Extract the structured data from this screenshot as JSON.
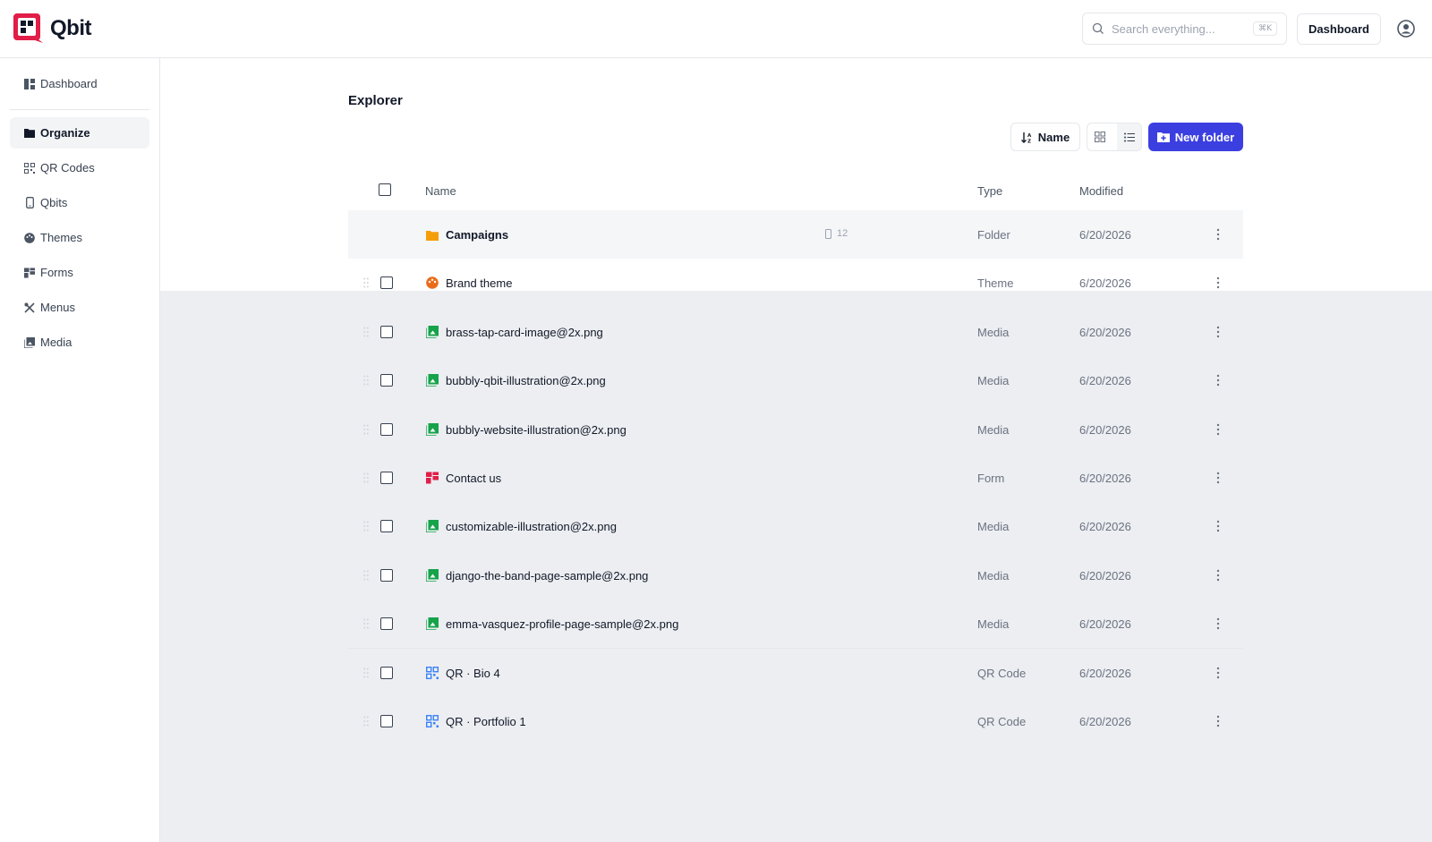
{
  "app": {
    "name": "Qbit"
  },
  "header": {
    "search_placeholder": "Search everything...",
    "search_shortcut": "⌘K",
    "dashboard_button": "Dashboard"
  },
  "sidebar": {
    "items": [
      {
        "label": "Dashboard",
        "icon": "dashboard-icon",
        "active": false
      },
      {
        "label": "Organize",
        "icon": "folder-icon",
        "active": true
      },
      {
        "label": "QR Codes",
        "icon": "qr-code-icon",
        "active": false
      },
      {
        "label": "Qbits",
        "icon": "phone-icon",
        "active": false
      },
      {
        "label": "Themes",
        "icon": "palette-icon",
        "active": false
      },
      {
        "label": "Forms",
        "icon": "form-icon",
        "active": false
      },
      {
        "label": "Menus",
        "icon": "utensils-icon",
        "active": false
      },
      {
        "label": "Media",
        "icon": "media-icon",
        "active": false
      }
    ]
  },
  "main": {
    "title": "Explorer",
    "sort_label": "Name",
    "new_folder_label": "New folder",
    "columns": {
      "name": "Name",
      "type": "Type",
      "modified": "Modified"
    },
    "rows": [
      {
        "name": "Campaigns",
        "type": "Folder",
        "modified": "6/20/2026",
        "icon": "folder-icon",
        "count": "12"
      },
      {
        "name": "Brand theme",
        "type": "Theme",
        "modified": "6/20/2026",
        "icon": "palette-icon"
      },
      {
        "name": "brass-tap-card-image@2x.png",
        "type": "Media",
        "modified": "6/20/2026",
        "icon": "image-icon"
      },
      {
        "name": "bubbly-qbit-illustration@2x.png",
        "type": "Media",
        "modified": "6/20/2026",
        "icon": "image-icon"
      },
      {
        "name": "bubbly-website-illustration@2x.png",
        "type": "Media",
        "modified": "6/20/2026",
        "icon": "image-icon"
      },
      {
        "name": "Contact us",
        "type": "Form",
        "modified": "6/20/2026",
        "icon": "form-icon"
      },
      {
        "name": "customizable-illustration@2x.png",
        "type": "Media",
        "modified": "6/20/2026",
        "icon": "image-icon"
      },
      {
        "name": "django-the-band-page-sample@2x.png",
        "type": "Media",
        "modified": "6/20/2026",
        "icon": "image-icon"
      },
      {
        "name": "emma-vasquez-profile-page-sample@2x.png",
        "type": "Media",
        "modified": "6/20/2026",
        "icon": "image-icon"
      },
      {
        "name": "QR · Bio 4",
        "type": "QR Code",
        "modified": "6/20/2026",
        "icon": "qr-code-icon"
      },
      {
        "name": "QR · Portfolio 1",
        "type": "QR Code",
        "modified": "6/20/2026",
        "icon": "qr-code-icon"
      }
    ]
  },
  "colors": {
    "accent": "#3b3fe0",
    "brand_red": "#e11d48",
    "folder_orange": "#f59e0b",
    "theme_orange": "#ea6c1a",
    "media_green": "#16a34a",
    "form_red": "#e11d48",
    "qr_blue": "#3b82f6",
    "overlay": "#eceef2"
  }
}
